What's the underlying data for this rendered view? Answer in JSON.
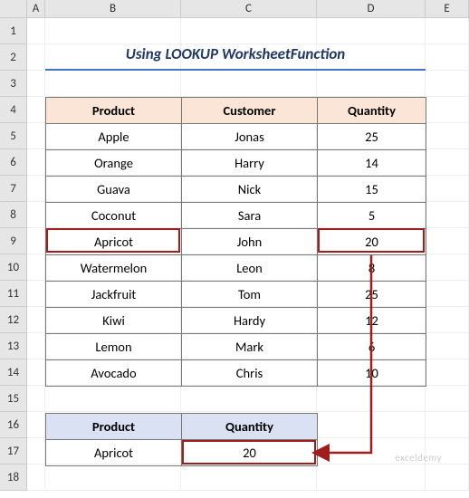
{
  "columns": [
    "A",
    "B",
    "C",
    "D",
    "E"
  ],
  "rows": [
    "1",
    "2",
    "3",
    "4",
    "5",
    "6",
    "7",
    "8",
    "9",
    "10",
    "11",
    "12",
    "13",
    "14",
    "15",
    "16",
    "17",
    "18"
  ],
  "title": "Using LOOKUP WorksheetFunction",
  "main_table": {
    "headers": {
      "product": "Product",
      "customer": "Customer",
      "quantity": "Quantity"
    },
    "rows": [
      {
        "product": "Apple",
        "customer": "Jonas",
        "quantity": "25"
      },
      {
        "product": "Orange",
        "customer": "Harry",
        "quantity": "14"
      },
      {
        "product": "Guava",
        "customer": "Nick",
        "quantity": "15"
      },
      {
        "product": "Coconut",
        "customer": "Sara",
        "quantity": "5"
      },
      {
        "product": "Apricot",
        "customer": "John",
        "quantity": "20"
      },
      {
        "product": "Watermelon",
        "customer": "Leon",
        "quantity": "8"
      },
      {
        "product": "Jackfruit",
        "customer": "Tom",
        "quantity": "25"
      },
      {
        "product": "Kiwi",
        "customer": "Hardy",
        "quantity": "12"
      },
      {
        "product": "Lemon",
        "customer": "Mark",
        "quantity": "6"
      },
      {
        "product": "Avocado",
        "customer": "Chris",
        "quantity": "10"
      }
    ]
  },
  "lookup_table": {
    "headers": {
      "product": "Product",
      "quantity": "Quantity"
    },
    "row": {
      "product": "Apricot",
      "quantity": "20"
    }
  },
  "watermark": "exceldemy",
  "chart_data": {
    "type": "table",
    "title": "Using LOOKUP WorksheetFunction",
    "series": [
      {
        "name": "Product",
        "values": [
          "Apple",
          "Orange",
          "Guava",
          "Coconut",
          "Apricot",
          "Watermelon",
          "Jackfruit",
          "Kiwi",
          "Lemon",
          "Avocado"
        ]
      },
      {
        "name": "Customer",
        "values": [
          "Jonas",
          "Harry",
          "Nick",
          "Sara",
          "John",
          "Leon",
          "Tom",
          "Hardy",
          "Mark",
          "Chris"
        ]
      },
      {
        "name": "Quantity",
        "values": [
          25,
          14,
          15,
          5,
          20,
          8,
          25,
          12,
          6,
          10
        ]
      }
    ],
    "lookup_result": {
      "Product": "Apricot",
      "Quantity": 20
    }
  }
}
